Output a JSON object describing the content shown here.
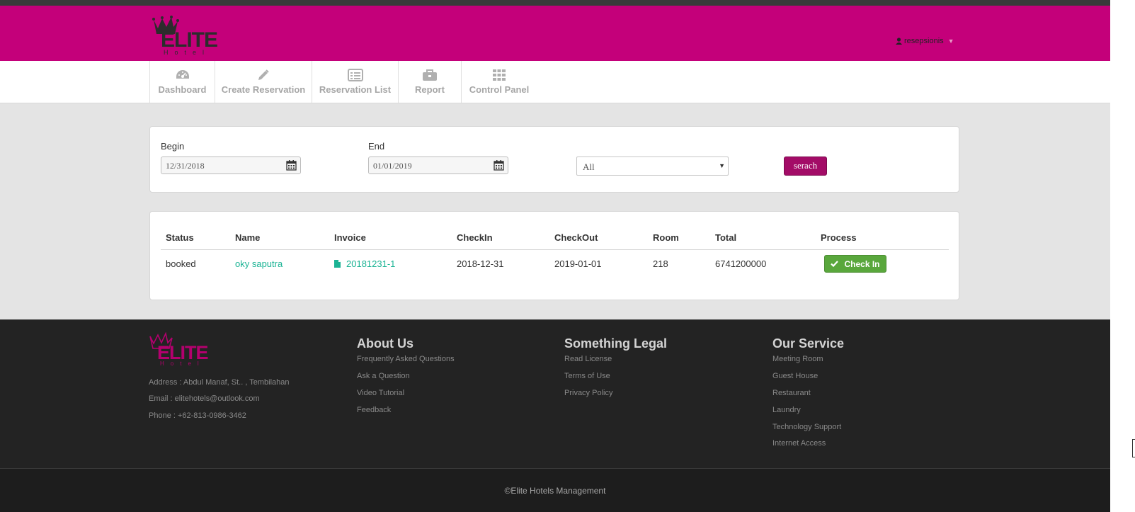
{
  "header": {
    "logo_text": "ELITE",
    "logo_sub": "Hotel",
    "user": "resepsionis",
    "brand_color": "#c4007a"
  },
  "nav": {
    "items": [
      {
        "label": "Dashboard",
        "icon": "dashboard-icon"
      },
      {
        "label": "Create Reservation",
        "icon": "pencil-icon"
      },
      {
        "label": "Reservation List",
        "icon": "list-icon"
      },
      {
        "label": "Report",
        "icon": "briefcase-icon"
      },
      {
        "label": "Control Panel",
        "icon": "grid-icon"
      }
    ]
  },
  "filter": {
    "begin_label": "Begin",
    "begin_value": "12/31/2018",
    "end_label": "End",
    "end_value": "01/01/2019",
    "status_selected": "All",
    "search_label": "serach"
  },
  "table": {
    "headers": [
      "Status",
      "Name",
      "Invoice",
      "CheckIn",
      "CheckOut",
      "Room",
      "Total",
      "Process"
    ],
    "rows": [
      {
        "status": "booked",
        "name": "oky saputra",
        "invoice": "20181231-1",
        "checkin": "2018-12-31",
        "checkout": "2019-01-01",
        "room": "218",
        "total": "6741200000",
        "process_label": "Check In"
      }
    ]
  },
  "footer": {
    "logo_text": "ELITE",
    "logo_sub": "Hotel",
    "address": "Address : Abdul Manaf, St.. , Tembilahan",
    "email": "Email : elitehotels@outlook.com",
    "phone": "Phone : +62-813-0986-3462",
    "columns": [
      {
        "title": "About Us",
        "links": [
          "Frequently Asked Questions",
          "Ask a Question",
          "Video Tutorial",
          "Feedback"
        ]
      },
      {
        "title": "Something Legal",
        "links": [
          "Read License",
          "Terms of Use",
          "Privacy Policy"
        ]
      },
      {
        "title": "Our Service",
        "links": [
          "Meeting Room",
          "Guest House",
          "Restaurant",
          "Laundry",
          "Technology Support",
          "Internet Access"
        ]
      }
    ],
    "copyright": "©Elite Hotels Management"
  }
}
